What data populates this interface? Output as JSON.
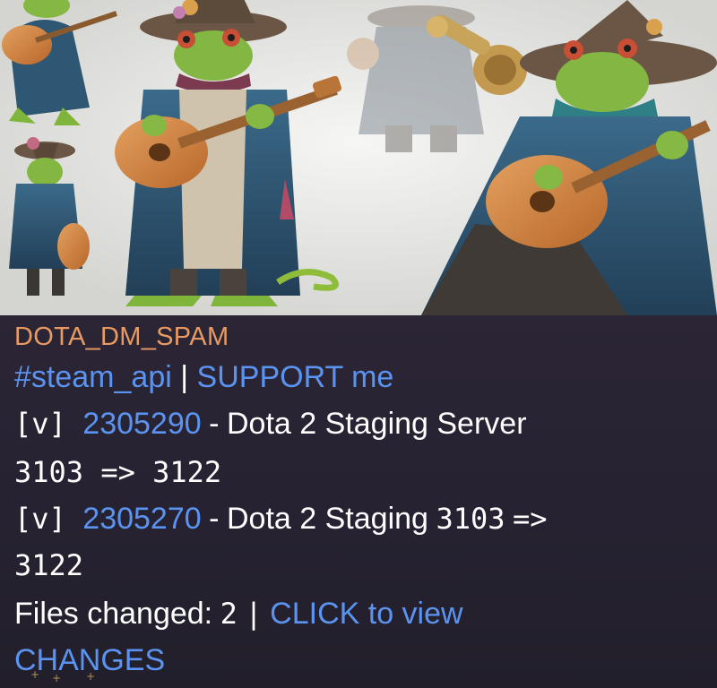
{
  "artwork": {
    "subject": "frog-bard-illustration",
    "colors": {
      "frog_skin": "#7fb53a",
      "coat_blue": "#2f5a78",
      "hat_brown": "#6b5645",
      "lute_orange": "#d0833d",
      "backdrop": "#e8e8e6"
    }
  },
  "message": {
    "sender": "DOTA_DM_SPAM",
    "tag_link": "#steam_api",
    "separator": "|",
    "support_link": "SUPPORT me",
    "entries": [
      {
        "prefix": "[v]",
        "app_id": "2305290",
        "dash": "-",
        "name": "Dota 2 Staging Server",
        "from": "3103",
        "arrow": "=>",
        "to": "3122"
      },
      {
        "prefix": "[v]",
        "app_id": "2305270",
        "dash": "-",
        "name": "Dota 2 Staging",
        "from": "3103",
        "arrow": "=>",
        "to": "3122"
      }
    ],
    "files_label": "Files changed:",
    "files_count": "2",
    "files_separator": "|",
    "view_link_line1": "CLICK to view",
    "view_link_line2": "CHANGES"
  },
  "colors": {
    "background": "#25212e",
    "sender": "#e99a62",
    "link": "#5b93f0",
    "text": "#ffffff"
  }
}
